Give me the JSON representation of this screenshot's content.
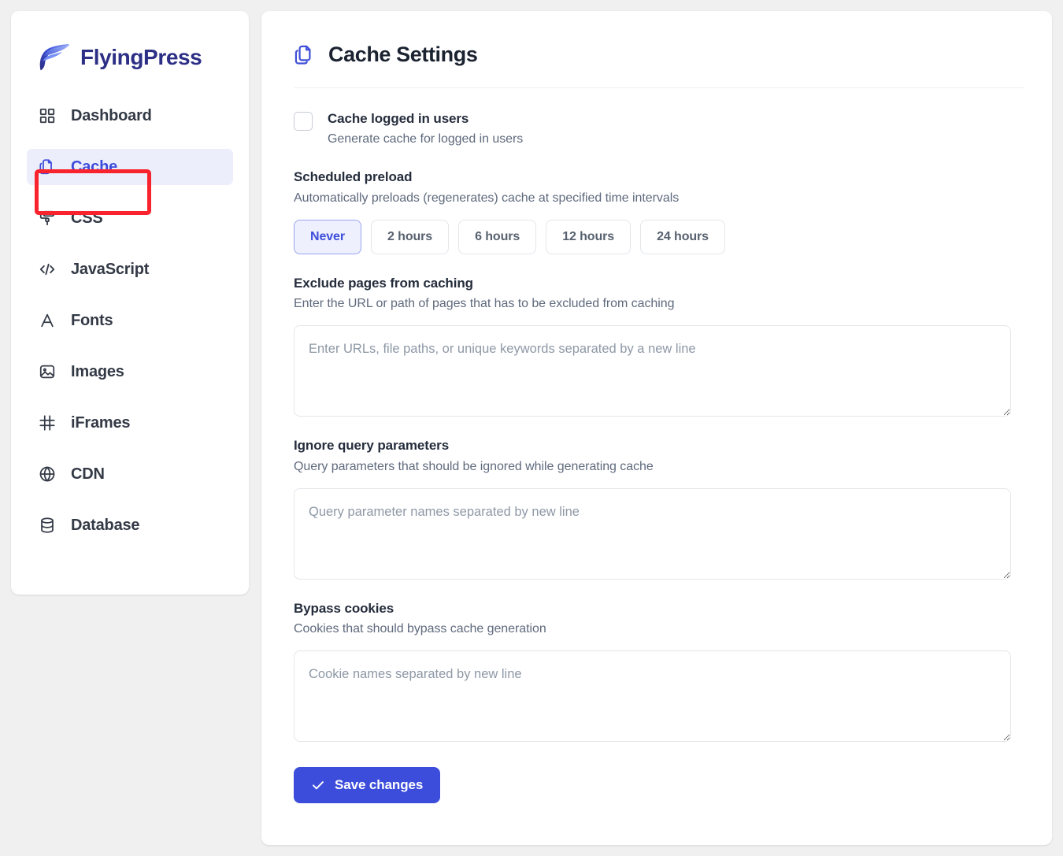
{
  "brand": {
    "name": "FlyingPress",
    "logo_icon": "flyingpress-logo-icon"
  },
  "sidebar": {
    "items": [
      {
        "label": "Dashboard",
        "icon": "grid-icon",
        "active": false
      },
      {
        "label": "Cache",
        "icon": "copy-icon",
        "active": true
      },
      {
        "label": "CSS",
        "icon": "paint-roller-icon",
        "active": false
      },
      {
        "label": "JavaScript",
        "icon": "code-brackets-icon",
        "active": false
      },
      {
        "label": "Fonts",
        "icon": "letter-a-icon",
        "active": false
      },
      {
        "label": "Images",
        "icon": "image-icon",
        "active": false
      },
      {
        "label": "iFrames",
        "icon": "hash-frame-icon",
        "active": false
      },
      {
        "label": "CDN",
        "icon": "globe-icon",
        "active": false
      },
      {
        "label": "Database",
        "icon": "database-icon",
        "active": false
      }
    ]
  },
  "annotation": {
    "highlight_target": "sidebar-item-cache",
    "highlight_color": "#f8232c"
  },
  "page": {
    "title": "Cache Settings",
    "title_icon": "copy-icon"
  },
  "settings": {
    "cache_logged_in": {
      "label": "Cache logged in users",
      "description": "Generate cache for logged in users",
      "checked": false
    },
    "scheduled_preload": {
      "label": "Scheduled preload",
      "description": "Automatically preloads (regenerates) cache at specified time intervals",
      "options": [
        "Never",
        "2 hours",
        "6 hours",
        "12 hours",
        "24 hours"
      ],
      "selected": "Never"
    },
    "exclude_pages": {
      "label": "Exclude pages from caching",
      "description": "Enter the URL or path of pages that has to be excluded from caching",
      "placeholder": "Enter URLs, file paths, or unique keywords separated by a new line",
      "value": ""
    },
    "ignore_query_params": {
      "label": "Ignore query parameters",
      "description": "Query parameters that should be ignored while generating cache",
      "placeholder": "Query parameter names separated by new line",
      "value": ""
    },
    "bypass_cookies": {
      "label": "Bypass cookies",
      "description": "Cookies that should bypass cache generation",
      "placeholder": "Cookie names separated by new line",
      "value": ""
    }
  },
  "actions": {
    "save_label": "Save changes",
    "save_icon": "check-icon",
    "save_color": "#3c4ddb"
  }
}
